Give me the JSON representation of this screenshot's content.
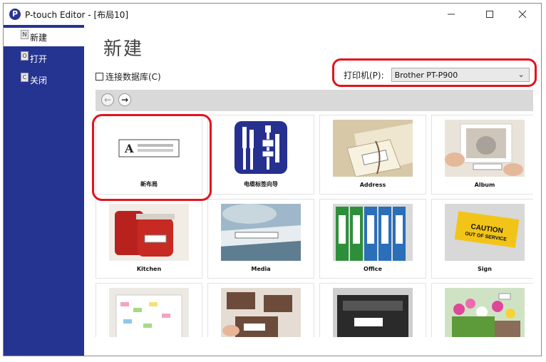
{
  "window": {
    "title": "P-touch Editor - [布局10]",
    "icon": "P",
    "controls": [
      "minimize-icon",
      "maximize-icon",
      "close-icon"
    ]
  },
  "sidebar": {
    "items": [
      {
        "label": "新建",
        "icon": "new-document-icon",
        "active": true
      },
      {
        "label": "打开",
        "icon": "open-document-icon",
        "active": false
      },
      {
        "label": "关闭",
        "icon": "close-document-icon",
        "active": false
      }
    ]
  },
  "main": {
    "title": "新建",
    "connect_db_label": "连接数据库(C)",
    "connect_db_checked": false,
    "printer_label": "打印机(P):",
    "printer_value": "Brother PT-P900",
    "nav": {
      "back_icon": "back-arrow-icon",
      "forward_icon": "forward-arrow-icon"
    }
  },
  "gallery": {
    "tiles": [
      {
        "label": "新布局",
        "icon": "new-layout-icon"
      },
      {
        "label": "电缆标签向导",
        "icon": "cable-label-wizard-icon"
      },
      {
        "label": "Address",
        "icon": "address-photo"
      },
      {
        "label": "Album",
        "icon": "album-photo"
      },
      {
        "label": "Kitchen",
        "icon": "kitchen-photo"
      },
      {
        "label": "Media",
        "icon": "media-photo"
      },
      {
        "label": "Office",
        "icon": "office-photo"
      },
      {
        "label": "Sign",
        "icon": "sign-photo"
      },
      {
        "label": "",
        "icon": "calendar-photo"
      },
      {
        "label": "",
        "icon": "labels-photo"
      },
      {
        "label": "",
        "icon": "device-photo"
      },
      {
        "label": "",
        "icon": "flowers-photo"
      }
    ],
    "sign_text": "CAUTION OUT OF SERVICE"
  }
}
